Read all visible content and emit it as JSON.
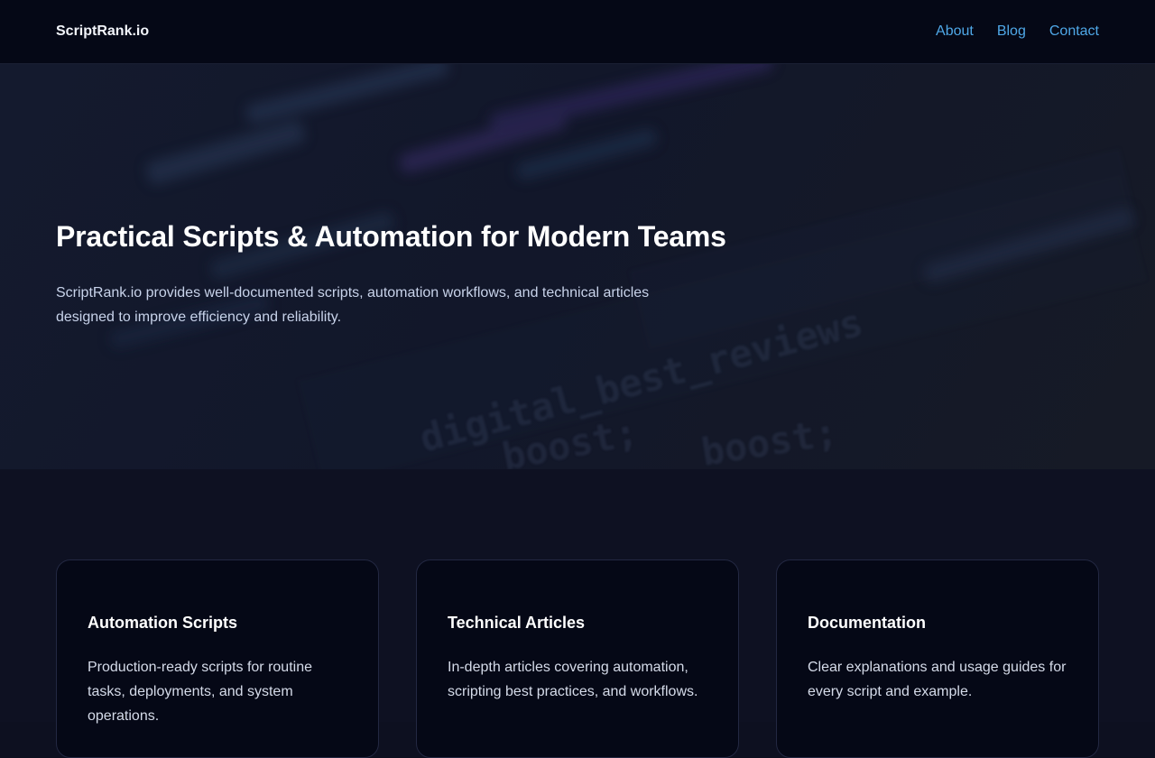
{
  "nav": {
    "brand": "ScriptRank.io",
    "links": [
      "About",
      "Blog",
      "Contact"
    ]
  },
  "hero": {
    "title": "Practical Scripts & Automation for Modern Teams",
    "text": "ScriptRank.io provides well-documented scripts, automation workflows, and technical articles designed to improve efficiency and reliability.",
    "background_code": [
      "digital_best_reviews",
      "boost;",
      "boost;"
    ]
  },
  "features": [
    {
      "title": "Automation Scripts",
      "text": "Production-ready scripts for routine tasks, deployments, and system operations."
    },
    {
      "title": "Technical Articles",
      "text": "In-depth articles covering automation, scripting best practices, and workflows."
    },
    {
      "title": "Documentation",
      "text": "Clear explanations and usage guides for every script and example."
    }
  ],
  "colors": {
    "nav_bg": "#050816",
    "link": "#4fa8e8",
    "card_bg": "#050816",
    "page_bg": "#0d1020"
  }
}
